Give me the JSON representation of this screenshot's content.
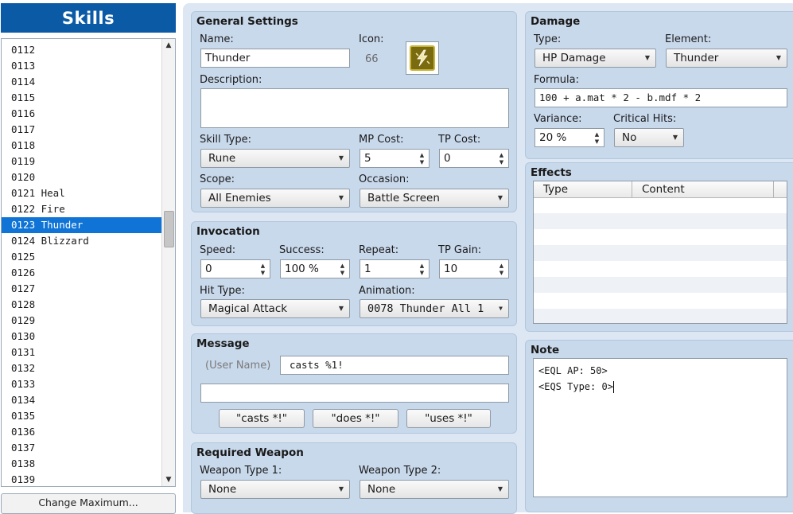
{
  "list": {
    "title": "Skills",
    "items": [
      {
        "label": "0112"
      },
      {
        "label": "0113"
      },
      {
        "label": "0114"
      },
      {
        "label": "0115"
      },
      {
        "label": "0116"
      },
      {
        "label": "0117"
      },
      {
        "label": "0118"
      },
      {
        "label": "0119"
      },
      {
        "label": "0120"
      },
      {
        "label": "0121 Heal"
      },
      {
        "label": "0122 Fire"
      },
      {
        "label": "0123 Thunder",
        "selected": true
      },
      {
        "label": "0124 Blizzard"
      },
      {
        "label": "0125"
      },
      {
        "label": "0126"
      },
      {
        "label": "0127"
      },
      {
        "label": "0128"
      },
      {
        "label": "0129"
      },
      {
        "label": "0130"
      },
      {
        "label": "0131"
      },
      {
        "label": "0132"
      },
      {
        "label": "0133"
      },
      {
        "label": "0134"
      },
      {
        "label": "0135"
      },
      {
        "label": "0136"
      },
      {
        "label": "0137"
      },
      {
        "label": "0138"
      },
      {
        "label": "0139"
      }
    ],
    "change_max_label": "Change Maximum..."
  },
  "general": {
    "title": "General Settings",
    "name_label": "Name:",
    "name_value": "Thunder",
    "icon_label": "Icon:",
    "icon_index": "66",
    "icon_name": "lightning-skill-icon",
    "description_label": "Description:",
    "description_value": "",
    "skill_type_label": "Skill Type:",
    "skill_type_value": "Rune",
    "mp_cost_label": "MP Cost:",
    "mp_cost_value": "5",
    "tp_cost_label": "TP Cost:",
    "tp_cost_value": "0",
    "scope_label": "Scope:",
    "scope_value": "All Enemies",
    "occasion_label": "Occasion:",
    "occasion_value": "Battle Screen"
  },
  "invocation": {
    "title": "Invocation",
    "speed_label": "Speed:",
    "speed_value": "0",
    "success_label": "Success:",
    "success_value": "100 %",
    "repeat_label": "Repeat:",
    "repeat_value": "1",
    "tp_gain_label": "TP Gain:",
    "tp_gain_value": "10",
    "hit_type_label": "Hit Type:",
    "hit_type_value": "Magical Attack",
    "animation_label": "Animation:",
    "animation_value": "0078 Thunder All 1"
  },
  "message": {
    "title": "Message",
    "user_name_placeholder": "(User Name)",
    "line1_value": "casts %1!",
    "line2_value": "",
    "buttons": [
      "\"casts *!\"",
      "\"does *!\"",
      "\"uses *!\""
    ]
  },
  "required_weapon": {
    "title": "Required Weapon",
    "type1_label": "Weapon Type 1:",
    "type1_value": "None",
    "type2_label": "Weapon Type 2:",
    "type2_value": "None"
  },
  "damage": {
    "title": "Damage",
    "type_label": "Type:",
    "type_value": "HP Damage",
    "element_label": "Element:",
    "element_value": "Thunder",
    "formula_label": "Formula:",
    "formula_value": "100 + a.mat * 2 - b.mdf * 2",
    "variance_label": "Variance:",
    "variance_value": "20 %",
    "critical_label": "Critical Hits:",
    "critical_value": "No"
  },
  "effects": {
    "title": "Effects",
    "columns": [
      "Type",
      "Content"
    ],
    "rows": []
  },
  "note": {
    "title": "Note",
    "lines": [
      "<EQL AP: 50>",
      "<EQS Type: 0>"
    ]
  },
  "colors": {
    "header_blue": "#0b5aa6",
    "selection_blue": "#0f74d6",
    "panel_bg": "#c9d9ec"
  }
}
